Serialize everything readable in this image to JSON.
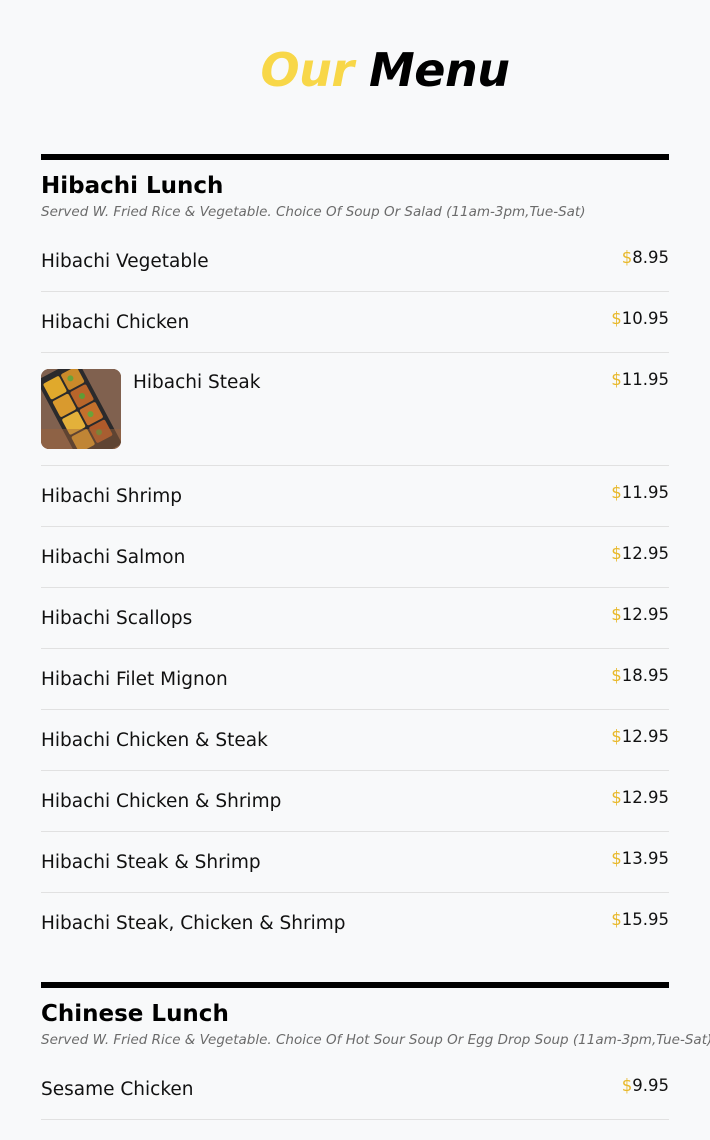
{
  "title": {
    "accent": "Our",
    "main": "Menu"
  },
  "colors": {
    "accent": "#f8d748",
    "currency": "#e8b82a",
    "rule": "#000000",
    "background": "#f8f9fa"
  },
  "sections": [
    {
      "heading": "Hibachi Lunch",
      "note": "Served W. Fried Rice & Vegetable. Choice Of Soup Or Salad (11am-3pm,Tue-Sat)",
      "items": [
        {
          "name": "Hibachi Vegetable",
          "currency": "$",
          "price": "8.95"
        },
        {
          "name": "Hibachi Chicken",
          "currency": "$",
          "price": "10.95"
        },
        {
          "name": "Hibachi Steak",
          "currency": "$",
          "price": "11.95",
          "thumbnail": "bento-box-photo"
        },
        {
          "name": "Hibachi Shrimp",
          "currency": "$",
          "price": "11.95"
        },
        {
          "name": "Hibachi Salmon",
          "currency": "$",
          "price": "12.95"
        },
        {
          "name": "Hibachi Scallops",
          "currency": "$",
          "price": "12.95"
        },
        {
          "name": "Hibachi Filet Mignon",
          "currency": "$",
          "price": "18.95"
        },
        {
          "name": "Hibachi Chicken & Steak",
          "currency": "$",
          "price": "12.95"
        },
        {
          "name": "Hibachi Chicken & Shrimp",
          "currency": "$",
          "price": "12.95"
        },
        {
          "name": "Hibachi Steak & Shrimp",
          "currency": "$",
          "price": "13.95"
        },
        {
          "name": "Hibachi Steak, Chicken & Shrimp",
          "currency": "$",
          "price": "15.95"
        }
      ]
    },
    {
      "heading": "Chinese Lunch",
      "note": "Served W. Fried Rice & Vegetable. Choice Of Hot Sour Soup Or Egg Drop Soup (11am-3pm,Tue-Sat)",
      "items": [
        {
          "name": "Sesame Chicken",
          "currency": "$",
          "price": "9.95"
        }
      ]
    }
  ]
}
